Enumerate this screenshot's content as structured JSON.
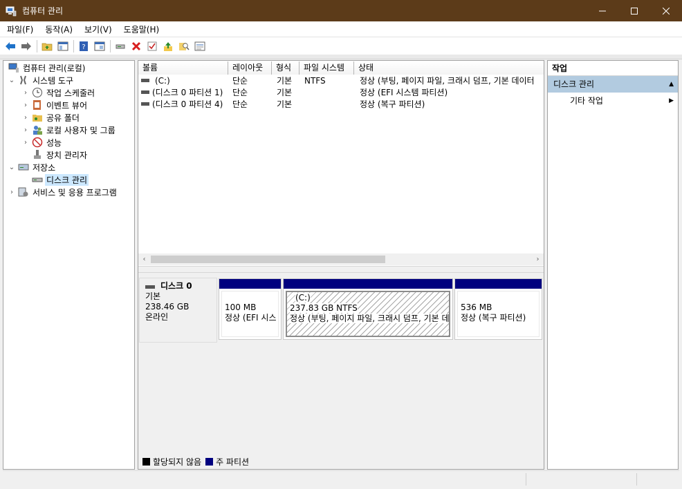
{
  "window": {
    "title": "컴퓨터 관리"
  },
  "menu": [
    "파일(F)",
    "동작(A)",
    "보기(V)",
    "도움말(H)"
  ],
  "toolbar_icons": [
    "back-arrow-icon",
    "forward-arrow-icon",
    "up-folder-icon",
    "show-tree-icon",
    "help-icon",
    "properties-icon",
    "connect-drive-icon",
    "delete-icon",
    "check-icon",
    "up-icon",
    "search-icon",
    "details-icon"
  ],
  "tree": [
    {
      "label": "컴퓨터 관리(로컬)"
    },
    {
      "label": "시스템 도구"
    },
    {
      "label": "작업 스케줄러"
    },
    {
      "label": "이벤트 뷰어"
    },
    {
      "label": "공유 폴더"
    },
    {
      "label": "로컬 사용자 및 그룹"
    },
    {
      "label": "성능"
    },
    {
      "label": "장치 관리자"
    },
    {
      "label": "저장소"
    },
    {
      "label": "디스크 관리"
    },
    {
      "label": "서비스 및 응용 프로그램"
    }
  ],
  "volume_list": {
    "columns": [
      "볼륨",
      "레이아웃",
      "형식",
      "파일 시스템",
      "상태"
    ],
    "rows": [
      {
        "volume": "(C:)",
        "layout": "단순",
        "type": "기본",
        "fs": "NTFS",
        "status": "정상 (부팅, 페이지 파일, 크래시 덤프, 기본 데이터"
      },
      {
        "volume": "(디스크 0 파티션 1)",
        "layout": "단순",
        "type": "기본",
        "fs": "",
        "status": "정상 (EFI 시스템 파티션)"
      },
      {
        "volume": "(디스크 0 파티션 4)",
        "layout": "단순",
        "type": "기본",
        "fs": "",
        "status": "정상 (복구 파티션)"
      }
    ]
  },
  "disk": {
    "name": "디스크 0",
    "kind": "기본",
    "size": "238.46 GB",
    "state": "온라인",
    "partitions": [
      {
        "title": "",
        "size": "100 MB",
        "status": "정상 (EFI 시스"
      },
      {
        "title": "(C:)",
        "size": "237.83 GB NTFS",
        "status": "정상 (부팅, 페이지 파일, 크래시 덤프, 기본 데"
      },
      {
        "title": "",
        "size": "536 MB",
        "status": "정상 (복구 파티션)"
      }
    ]
  },
  "legend": [
    {
      "label": "할당되지 않음",
      "color": "#000000"
    },
    {
      "label": "주 파티션",
      "color": "#00007f"
    }
  ],
  "actions": {
    "header": "작업",
    "selected": "디스크 관리",
    "sub": "기타 작업"
  }
}
